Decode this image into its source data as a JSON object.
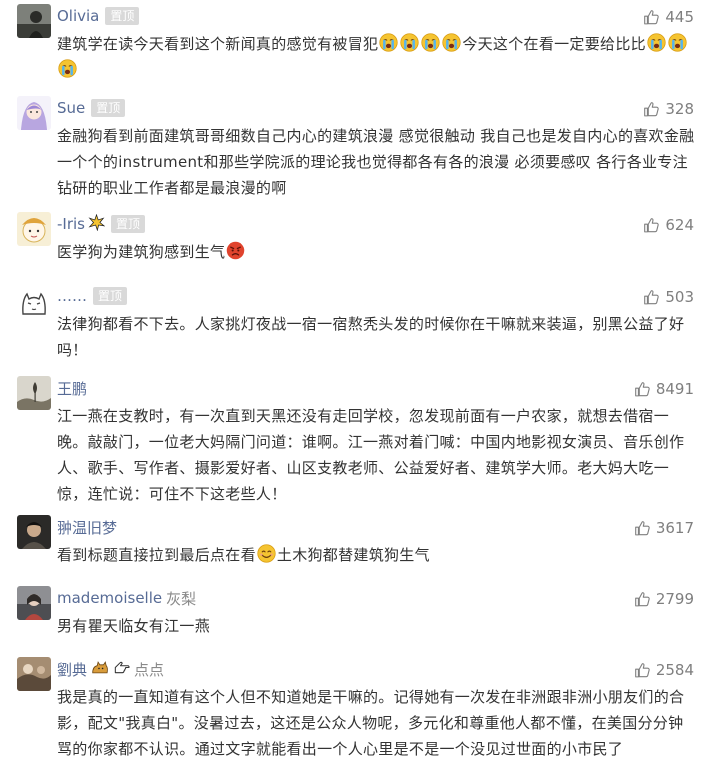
{
  "pinned_label": "置顶",
  "comments": [
    {
      "user": "Olivia",
      "likes": "445",
      "text_a": "建筑学在读今天看到这个新闻真的感觉有被冒犯",
      "text_b": "今天这个在看一定要给比比",
      "emoji": "crying-face"
    },
    {
      "user": "Sue",
      "likes": "328",
      "text": "金融狗看到前面建筑哥哥细数自己内心的建筑浪漫 感觉很触动 我自己也是发自内心的喜欢金融 一个个的instrument和那些学院派的理论我也觉得都各有各的浪漫 必须要感叹 各行各业专注钻研的职业工作者都是最浪漫的啊"
    },
    {
      "user": "-Iris",
      "likes": "624",
      "text": "医学狗为建筑狗感到生气",
      "emoji": "angry-face"
    },
    {
      "user": "……",
      "likes": "503",
      "text": "法律狗都看不下去。人家挑灯夜战一宿一宿熬秃头发的时候你在干嘛就来装逼，别黑公益了好吗！"
    },
    {
      "user": "王鹏",
      "likes": "8491",
      "text": "江一燕在支教时，有一次直到天黑还没有走回学校，忽发现前面有一户农家，就想去借宿一晚。敲敲门，一位老大妈隔门问道：谁啊。江一燕对着门喊：中国内地影视女演员、音乐创作人、歌手、写作者、摄影爱好者、山区支教老师、公益爱好者、建筑学大师。老大妈大吃一惊，连忙说：可住不下这老些人！"
    },
    {
      "user": "翀温旧梦",
      "likes": "3617",
      "text_a": "看到标题直接拉到最后点在看",
      "text_b": "土木狗都替建筑狗生气",
      "emoji": "smile-face"
    },
    {
      "user": "mademoiselle",
      "user_extra": "灰梨",
      "likes": "2799",
      "text": "男有瞿天临女有江一燕"
    },
    {
      "user": "劉典",
      "user_extra": "点点",
      "likes": "2584",
      "text": "我是真的一直知道有这个人但不知道她是干嘛的。记得她有一次发在非洲跟非洲小朋友们的合影，配文\"我真白\"。没暑过去，这还是公众人物呢，多元化和尊重他人都不懂，在美国分分钟骂的你家都不认识。通过文字就能看出一个人心里是不是一个没见过世面的小市民了"
    }
  ],
  "colors": {
    "name": "#576b95",
    "text": "#333333",
    "meta": "#7f7f7f",
    "pin_bg": "#d9d9d9"
  },
  "icons": {
    "like": "thumbs-up-icon",
    "pin": "pinned-badge",
    "spark": "spark-emoji-icon",
    "dog": "dog-emoji-icon",
    "point": "pointing-hand-emoji-icon"
  }
}
